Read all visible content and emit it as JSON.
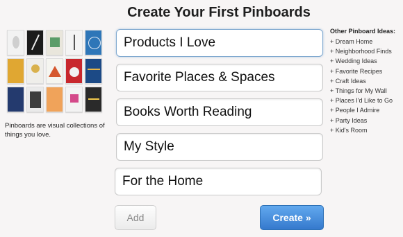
{
  "title": "Create Your First Pinboards",
  "caption": "Pinboards are visual collections of things you love.",
  "boards": [
    "Products I Love",
    "Favorite Places & Spaces",
    "Books Worth Reading",
    "My Style",
    "For the Home"
  ],
  "buttons": {
    "add": "Add",
    "create": "Create »"
  },
  "ideas": {
    "heading": "Other Pinboard Ideas:",
    "items": [
      "+ Dream Home",
      "+ Neighborhood Finds",
      "+ Wedding Ideas",
      "+ Favorite Recipes",
      "+ Craft Ideas",
      "+ Things for My Wall",
      "+ Places I'd Like to Go",
      "+ People I Admire",
      "+ Party Ideas",
      "+ Kid's Room"
    ]
  },
  "colors": {
    "create_button": "#3f86d8",
    "background": "#f7f5f5",
    "focus_border": "#7fa8cf"
  }
}
